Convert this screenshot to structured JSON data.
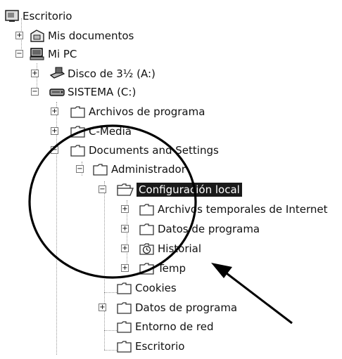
{
  "tree": {
    "items": [
      {
        "label": "Escritorio",
        "icon": "desktop-icon",
        "expander": "",
        "selected": false
      },
      {
        "label": "Mis documentos",
        "icon": "my-documents-icon",
        "expander": "+",
        "selected": false
      },
      {
        "label": "Mi PC",
        "icon": "my-computer-icon",
        "expander": "−",
        "selected": false
      },
      {
        "label": "Disco de 3½ (A:)",
        "icon": "floppy-drive-icon",
        "expander": "+",
        "selected": false
      },
      {
        "label": "SISTEMA (C:)",
        "icon": "hard-drive-icon",
        "expander": "−",
        "selected": false
      },
      {
        "label": "Archivos de programa",
        "icon": "folder-icon",
        "expander": "+",
        "selected": false
      },
      {
        "label": "C-Media",
        "icon": "folder-icon",
        "expander": "+",
        "selected": false
      },
      {
        "label": "Documents and Settings",
        "icon": "folder-icon",
        "expander": "−",
        "selected": false
      },
      {
        "label": "Administrador",
        "icon": "folder-icon",
        "expander": "−",
        "selected": false
      },
      {
        "label": "Configuración local",
        "icon": "folder-open-icon",
        "expander": "−",
        "selected": true
      },
      {
        "label": "Archivos temporales de Internet",
        "icon": "folder-icon",
        "expander": "+",
        "selected": false
      },
      {
        "label": "Datos de programa",
        "icon": "folder-icon",
        "expander": "+",
        "selected": false
      },
      {
        "label": "Historial",
        "icon": "history-folder-icon",
        "expander": "+",
        "selected": false
      },
      {
        "label": "Temp",
        "icon": "folder-icon",
        "expander": "+",
        "selected": false
      },
      {
        "label": "Cookies",
        "icon": "folder-icon",
        "expander": "",
        "selected": false
      },
      {
        "label": "Datos de programa",
        "icon": "folder-icon",
        "expander": "+",
        "selected": false
      },
      {
        "label": "Entorno de red",
        "icon": "folder-icon",
        "expander": "",
        "selected": false
      },
      {
        "label": "Escritorio",
        "icon": "folder-icon",
        "expander": "",
        "selected": false
      }
    ]
  },
  "colors": {
    "selection_bg": "#1a1a1a",
    "selection_text": "#ffffff",
    "annotation_stroke": "#000000"
  }
}
